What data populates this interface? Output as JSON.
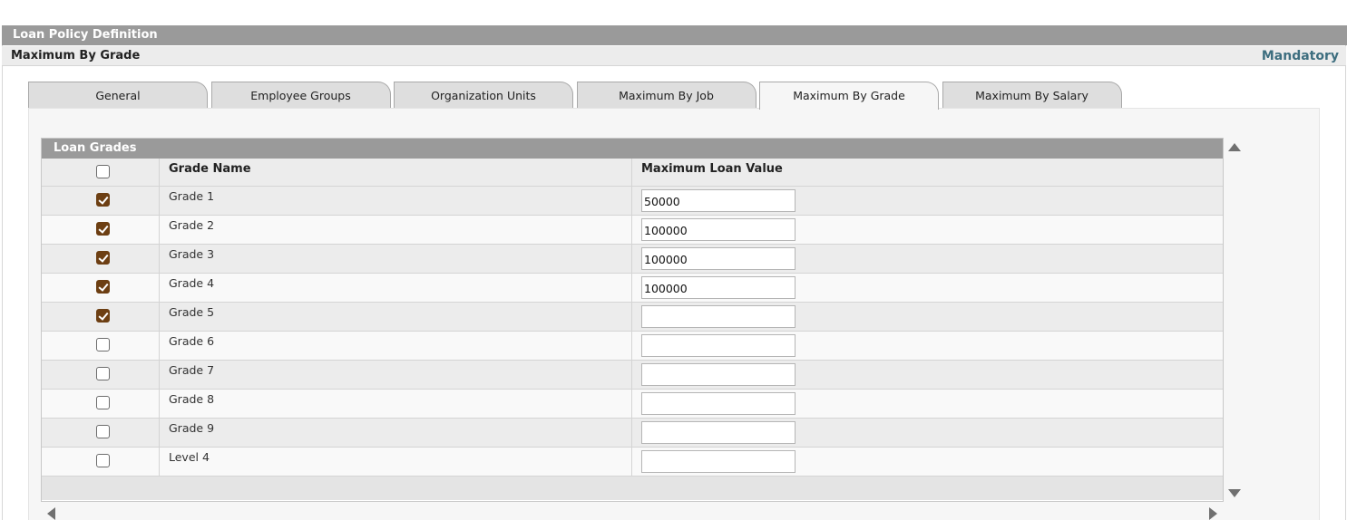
{
  "window": {
    "title": "Loan Policy Definition"
  },
  "section": {
    "title": "Maximum By Grade",
    "mandatory_label": "Mandatory"
  },
  "tabs": [
    {
      "label": "General",
      "active": false
    },
    {
      "label": "Employee Groups",
      "active": false
    },
    {
      "label": "Organization Units",
      "active": false
    },
    {
      "label": "Maximum By Job",
      "active": false
    },
    {
      "label": "Maximum By Grade",
      "active": true
    },
    {
      "label": "Maximum By Salary",
      "active": false
    }
  ],
  "grid": {
    "title": "Loan Grades",
    "select_all_checked": false,
    "columns": {
      "grade_name": "Grade Name",
      "max_loan_value": "Maximum Loan Value"
    },
    "rows": [
      {
        "grade": "Grade 1",
        "checked": true,
        "value": "50000"
      },
      {
        "grade": "Grade 2",
        "checked": true,
        "value": "100000"
      },
      {
        "grade": "Grade 3",
        "checked": true,
        "value": "100000"
      },
      {
        "grade": "Grade 4",
        "checked": true,
        "value": "100000"
      },
      {
        "grade": "Grade 5",
        "checked": true,
        "value": ""
      },
      {
        "grade": "Grade 6",
        "checked": false,
        "value": ""
      },
      {
        "grade": "Grade 7",
        "checked": false,
        "value": ""
      },
      {
        "grade": "Grade 8",
        "checked": false,
        "value": ""
      },
      {
        "grade": "Grade 9",
        "checked": false,
        "value": ""
      },
      {
        "grade": "Level 4",
        "checked": false,
        "value": ""
      }
    ]
  },
  "colors": {
    "title_bar": "#9a9a9a",
    "mandatory": "#3d6e7f",
    "checkbox_checked": "#6d3f13"
  },
  "icons": {
    "scroll_up": "triangle-up-icon",
    "scroll_down": "triangle-down-icon",
    "scroll_left": "triangle-left-icon",
    "scroll_right": "triangle-right-icon"
  }
}
